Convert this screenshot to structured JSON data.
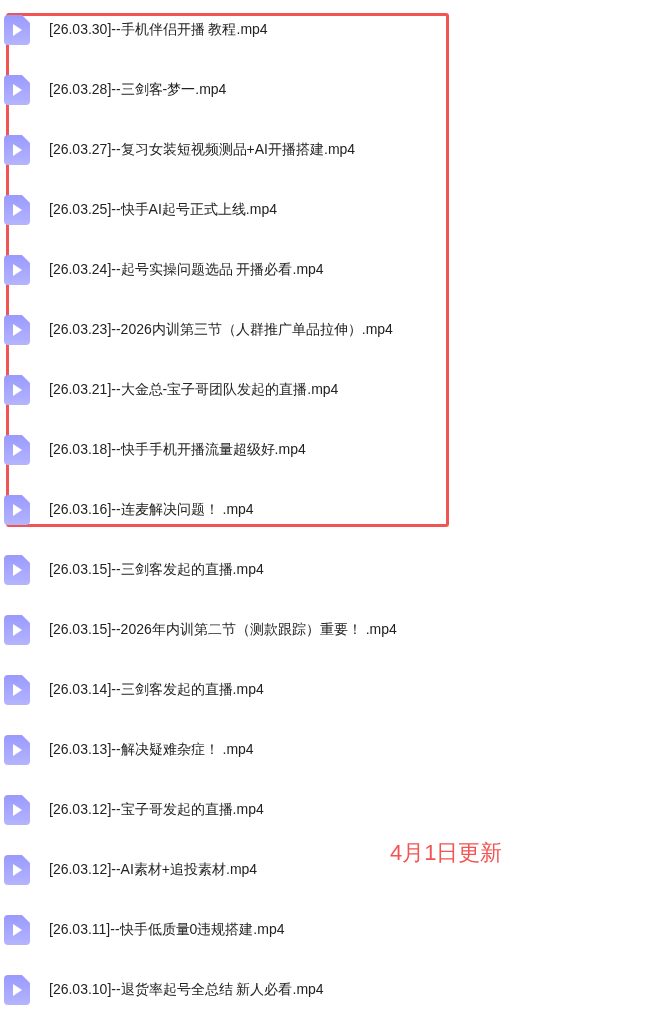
{
  "framed_files": [
    {
      "name": "[26.03.30]--手机伴侣开播 教程.mp4"
    },
    {
      "name": "[26.03.28]--三剑客-梦一.mp4"
    },
    {
      "name": "[26.03.27]--复习女装短视频测品+AI开播搭建.mp4"
    },
    {
      "name": "[26.03.25]--快手AI起号正式上线.mp4"
    },
    {
      "name": "[26.03.24]--起号实操问题选品 开播必看.mp4"
    },
    {
      "name": "[26.03.23]--2026内训第三节（人群推广单品拉伸）.mp4"
    },
    {
      "name": "[26.03.21]--大金总-宝子哥团队发起的直播.mp4"
    },
    {
      "name": "[26.03.18]--快手手机开播流量超级好.mp4"
    },
    {
      "name": "[26.03.16]--连麦解决问题！ .mp4"
    }
  ],
  "files": [
    {
      "name": "[26.03.15]--三剑客发起的直播.mp4"
    },
    {
      "name": "[26.03.15]--2026年内训第二节（测款跟踪）重要！ .mp4"
    },
    {
      "name": "[26.03.14]--三剑客发起的直播.mp4"
    },
    {
      "name": "[26.03.13]--解决疑难杂症！ .mp4"
    },
    {
      "name": "[26.03.12]--宝子哥发起的直播.mp4"
    },
    {
      "name": "[26.03.12]--AI素材+追投素材.mp4"
    },
    {
      "name": "[26.03.11]--快手低质量0违规搭建.mp4"
    },
    {
      "name": "[26.03.10]--退货率起号全总结 新人必看.mp4"
    }
  ],
  "annotation": "4月1日更新"
}
